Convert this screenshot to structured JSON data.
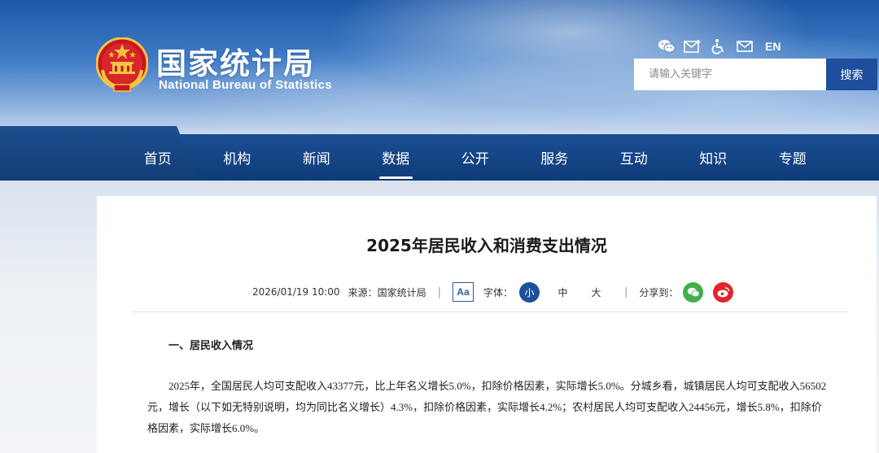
{
  "header": {
    "logo_cn": "国家统计局",
    "logo_en": "National Bureau of Statistics",
    "top_icons": [
      "wechat-icon",
      "mail-add-icon",
      "accessibility-icon",
      "mail-icon"
    ],
    "lang_label": "EN",
    "search_placeholder": "请输入关键字",
    "search_button": "搜索"
  },
  "nav": {
    "items": [
      "首页",
      "机构",
      "新闻",
      "数据",
      "公开",
      "服务",
      "互动",
      "知识",
      "专题"
    ],
    "active": "数据"
  },
  "article": {
    "title": "2025年居民收入和消费支出情况",
    "date": "2026/01/19 10:00",
    "source": "来源：国家统计局",
    "aa_label": "Aa",
    "font_label": "字体：",
    "font_small": "小",
    "font_medium": "中",
    "font_large": "大",
    "share_label": "分享到：",
    "section_heading": "一、居民收入情况",
    "paragraph": "2025年，全国居民人均可支配收入43377元，比上年名义增长5.0%，扣除价格因素，实际增长5.0%。分城乡看，城镇居民人均可支配收入56502元，增长（以下如无特别说明，均为同比名义增长）4.3%，扣除价格因素，实际增长4.2%；农村居民人均可支配收入24456元，增长5.8%，扣除价格因素，实际增长6.0%。"
  },
  "colors": {
    "nav_bg": "#123d76",
    "accent_blue": "#1f4e9c",
    "wechat_green": "#3fb04a",
    "weibo_red": "#e0262c"
  }
}
